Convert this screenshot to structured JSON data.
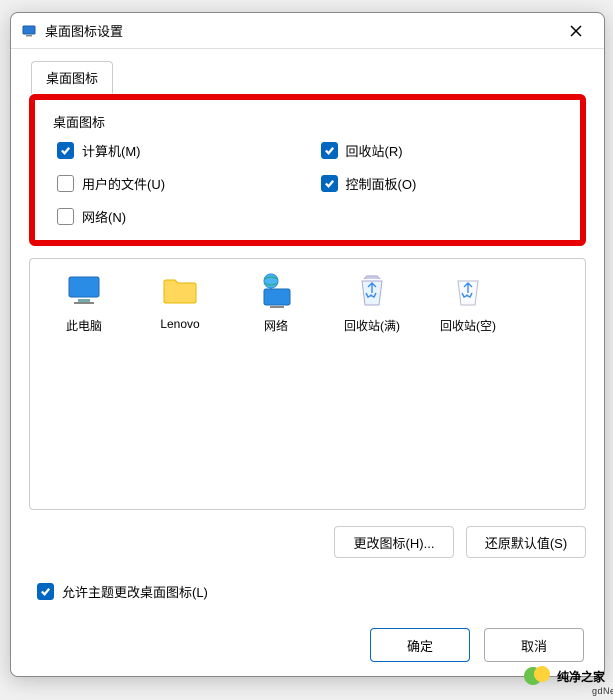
{
  "window": {
    "title": "桌面图标设置"
  },
  "tab": {
    "label": "桌面图标"
  },
  "group": {
    "title": "桌面图标"
  },
  "checkboxes": {
    "computer": {
      "label": "计算机(M)",
      "checked": true
    },
    "recycle": {
      "label": "回收站(R)",
      "checked": true
    },
    "userfiles": {
      "label": "用户的文件(U)",
      "checked": false
    },
    "cpanel": {
      "label": "控制面板(O)",
      "checked": true
    },
    "network": {
      "label": "网络(N)",
      "checked": false
    }
  },
  "icons": {
    "thispc": {
      "label": "此电脑"
    },
    "lenovo": {
      "label": "Lenovo"
    },
    "network": {
      "label": "网络"
    },
    "rbfull": {
      "label": "回收站(满)"
    },
    "rbempty": {
      "label": "回收站(空)"
    }
  },
  "buttons": {
    "changeIcon": "更改图标(H)...",
    "restoreDefault": "还原默认值(S)",
    "ok": "确定",
    "cancel": "取消"
  },
  "themeCheckbox": {
    "label": "允许主题更改桌面图标(L)",
    "checked": true
  },
  "watermark": {
    "text": "纯净之家",
    "sub": "gdNet.com"
  }
}
